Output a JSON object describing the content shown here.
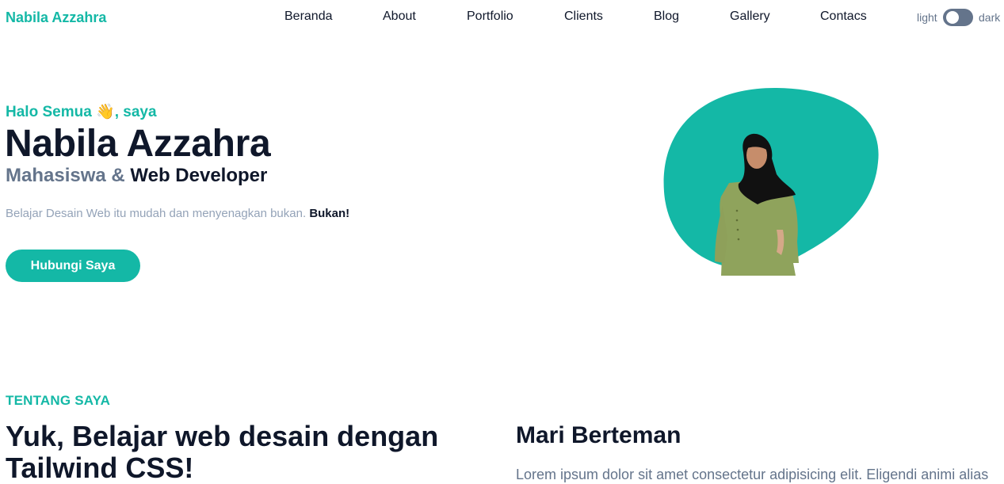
{
  "navbar": {
    "brand": "Nabila Azzahra",
    "items": [
      {
        "label": "Beranda"
      },
      {
        "label": "About"
      },
      {
        "label": "Portfolio"
      },
      {
        "label": "Clients"
      },
      {
        "label": "Blog"
      },
      {
        "label": "Gallery"
      },
      {
        "label": "Contacs"
      }
    ],
    "theme_toggle": {
      "light_label": "light",
      "dark_label": "dark",
      "state": "light"
    }
  },
  "hero": {
    "greeting": "Halo Semua 👋, saya",
    "name": "Nabila Azzahra",
    "role_prefix": "Mahasiswa &",
    "role_strong": "Web Developer",
    "tagline": "Belajar Desain Web itu mudah dan menyenagkan bukan.",
    "tagline_strong": "Bukan!",
    "cta_label": "Hubungi Saya"
  },
  "about": {
    "label": "TENTANG SAYA",
    "title": "Yuk, Belajar web desain dengan Tailwind CSS!",
    "side_title": "Mari Berteman",
    "side_text": "Lorem ipsum dolor sit amet consectetur adipisicing elit. Eligendi animi alias"
  },
  "colors": {
    "accent": "#14b8a6",
    "heading": "#0f172a",
    "muted": "#64748b",
    "light_muted": "#94a3b8"
  }
}
